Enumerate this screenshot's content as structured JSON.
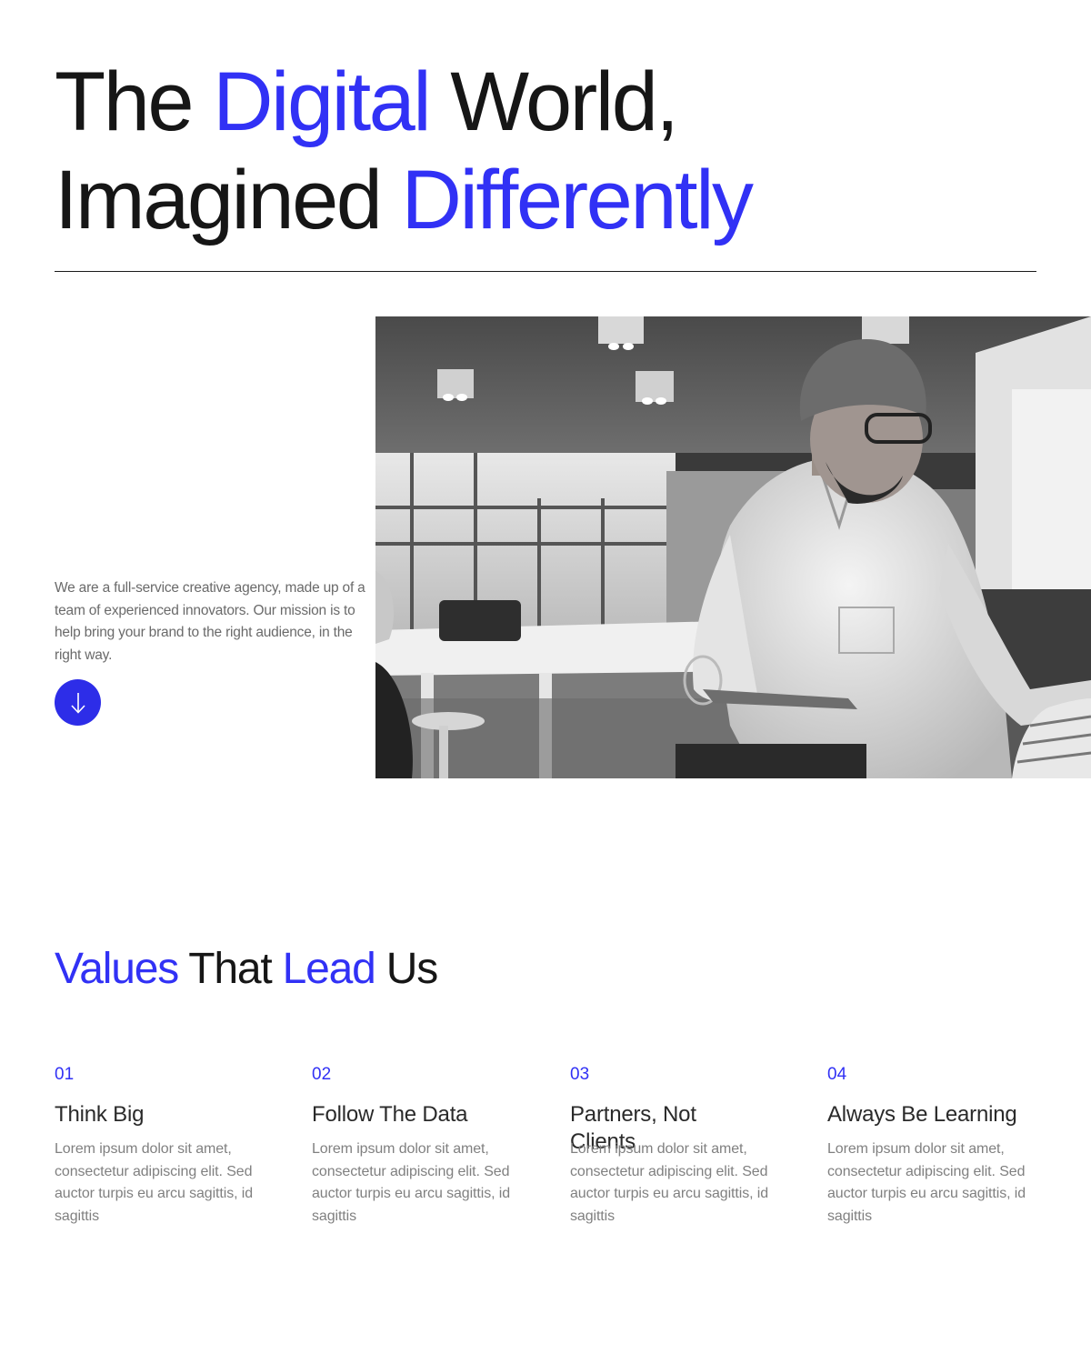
{
  "hero": {
    "title_part1": "The ",
    "title_accent1": "Digital",
    "title_part2": " World,",
    "title_part3": "Imagined ",
    "title_accent2": "Differently"
  },
  "intro": {
    "text": "We are a full-service creative agency, made up of a team of experienced innovators. Our mission is to help bring your brand to the right audience, in the right way."
  },
  "scroll_button": {
    "icon": "arrow-down-icon"
  },
  "photo": {
    "icon": "team-photo"
  },
  "values": {
    "title_accent1": "Values",
    "title_part1": " That ",
    "title_accent2": "Lead",
    "title_part2": " Us",
    "items": [
      {
        "num": "01",
        "title": "Think Big",
        "body": "Lorem ipsum dolor sit amet, consectetur adipiscing elit. Sed auctor turpis eu arcu sagittis, id sagittis"
      },
      {
        "num": "02",
        "title": "Follow The Data",
        "body": "Lorem ipsum dolor sit amet, consectetur adipiscing elit. Sed auctor turpis eu arcu sagittis, id sagittis"
      },
      {
        "num": "03",
        "title": "Partners, Not Clients",
        "body": "Lorem ipsum dolor sit amet, consectetur adipiscing elit. Sed auctor turpis eu arcu sagittis, id sagittis"
      },
      {
        "num": "04",
        "title": "Always Be Learning",
        "body": "Lorem ipsum dolor sit amet, consectetur adipiscing elit. Sed auctor turpis eu arcu sagittis, id sagittis"
      }
    ]
  },
  "colors": {
    "accent": "#3131f5",
    "button": "#2d2de8",
    "text": "#161616",
    "muted": "#808080"
  }
}
